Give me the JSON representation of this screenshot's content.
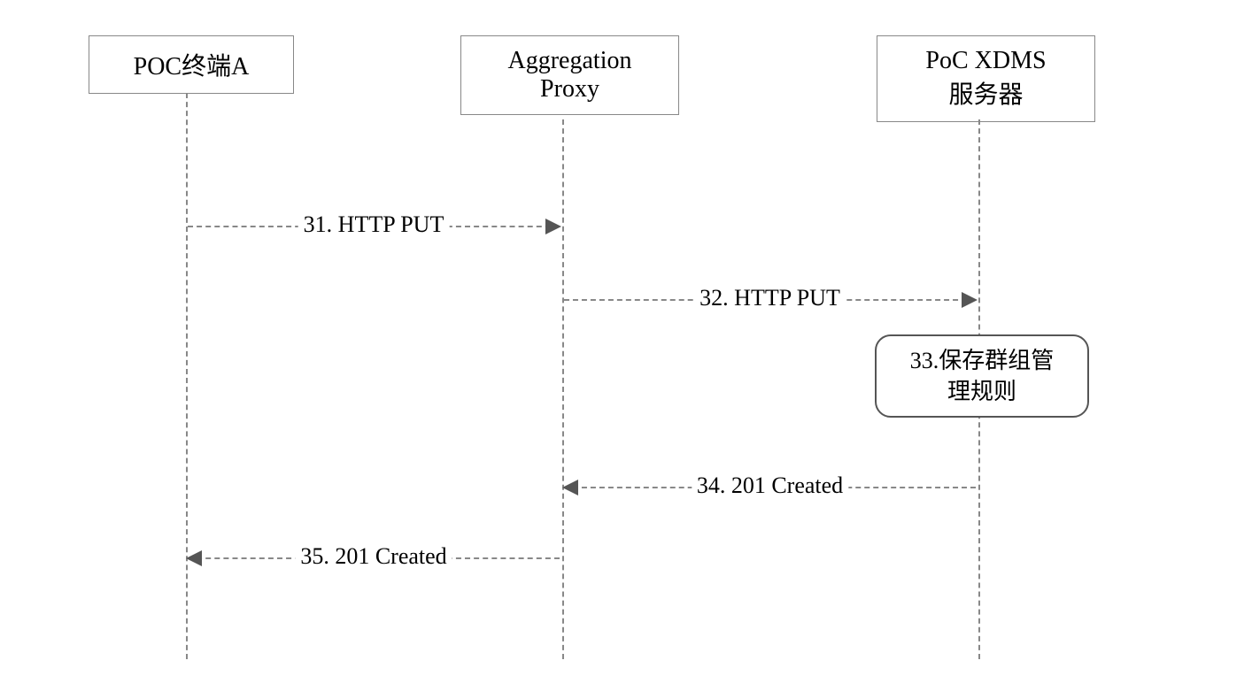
{
  "participants": {
    "a": "POC终端A",
    "b": "Aggregation\nProxy",
    "c": "PoC XDMS\n服务器"
  },
  "messages": {
    "m31": "31. HTTP PUT",
    "m32": "32. HTTP PUT",
    "m34": "34. 201 Created",
    "m35": "35. 201 Created"
  },
  "note": "33.保存群组管\n理规则"
}
